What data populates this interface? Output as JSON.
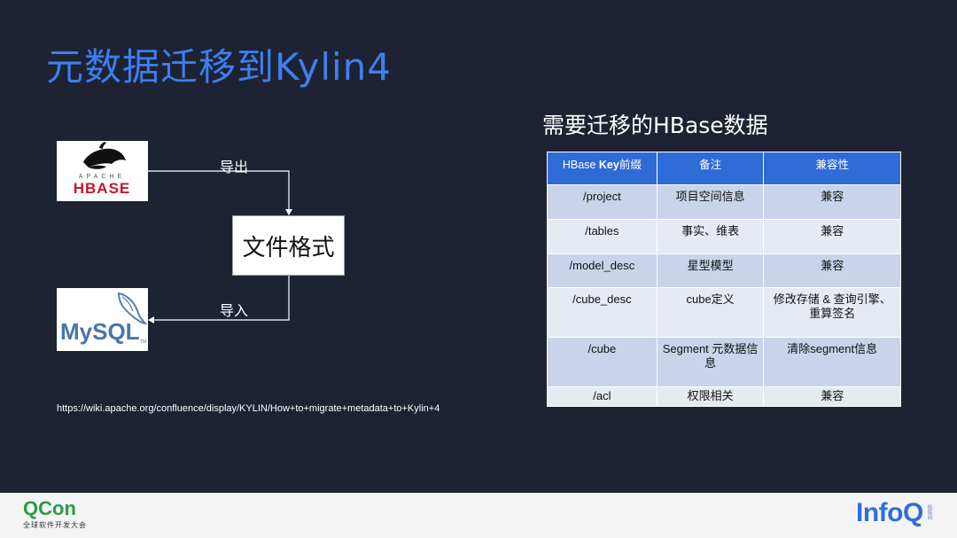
{
  "slide": {
    "title": "元数据迁移到Kylin4",
    "subtitle": "需要迁移的HBase数据",
    "reference_url": "https://wiki.apache.org/confluence/display/KYLIN/How+to+migrate+metadata+to+Kylin+4"
  },
  "diagram": {
    "hbase_logo": {
      "top_text": "APACHE",
      "name": "HBASE"
    },
    "mysql_logo": {
      "name": "MySQL",
      "tm": "TM"
    },
    "format_box_label": "文件格式",
    "export_label": "导出",
    "import_label": "导入"
  },
  "table": {
    "headers": {
      "col1_prefix": "HBase ",
      "col1_bold": "Key",
      "col1_suffix": "前缀",
      "col2": "备注",
      "col3": "兼容性"
    },
    "rows": [
      {
        "key": "/project",
        "note": "项目空间信息",
        "compat": "兼容"
      },
      {
        "key": "/tables",
        "note": "事实、维表",
        "compat": "兼容"
      },
      {
        "key": "/model_desc",
        "note": "星型模型",
        "compat": "兼容"
      },
      {
        "key": "/cube_desc",
        "note": "cube定义",
        "compat": "修改存储 & 查询引擎、重算签名"
      },
      {
        "key": "/cube",
        "note": "Segment 元数据信息",
        "compat": "清除segment信息"
      },
      {
        "key": "/acl",
        "note": "权限相关",
        "compat": "兼容"
      }
    ]
  },
  "footer": {
    "qcon_name": "QCon",
    "qcon_sub": "全球软件开发大会",
    "infoq_name": "InfoQ",
    "infoq_tag": "极客邦"
  },
  "colors": {
    "title_blue": "#3d7ff0",
    "background": "#1d2333",
    "table_header": "#2e6bd6",
    "qcon_green": "#2a9b4a",
    "infoq_blue": "#2f6fd8"
  }
}
